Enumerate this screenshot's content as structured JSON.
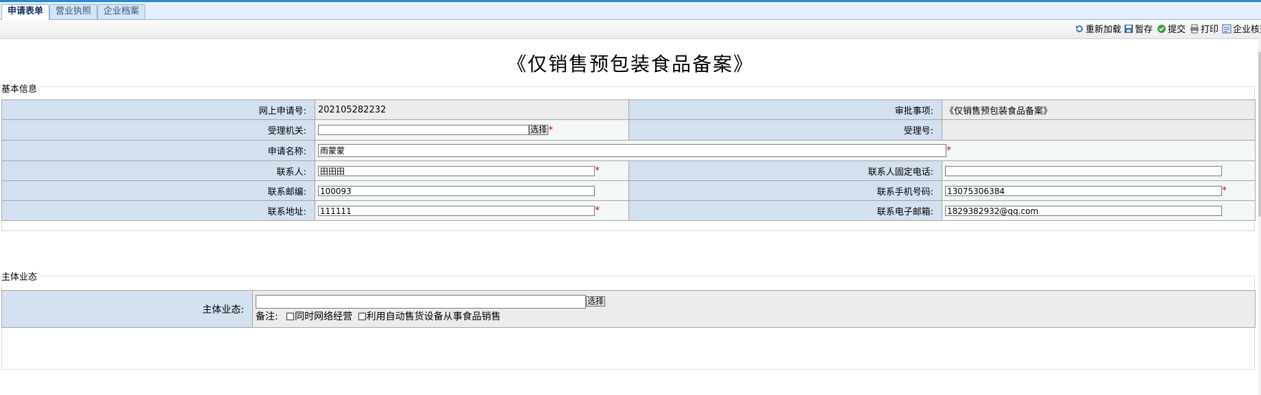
{
  "tabs": [
    {
      "label": "申请表单",
      "active": true
    },
    {
      "label": "营业执照",
      "active": false
    },
    {
      "label": "企业档案",
      "active": false
    }
  ],
  "toolbar": {
    "reload": {
      "label": "重新加载",
      "icon": "reload-icon"
    },
    "save": {
      "label": "暂存",
      "icon": "floppy-disk-icon"
    },
    "submit": {
      "label": "提交",
      "icon": "check-circle-icon"
    },
    "print": {
      "label": "打印",
      "icon": "printer-icon"
    },
    "verify": {
      "label": "企业核查",
      "icon": "document-icon"
    }
  },
  "page_title": "《仅销售预包装食品备案》",
  "basic_info": {
    "legend": "基本信息",
    "online_no_label": "网上申请号:",
    "online_no": "202105282232",
    "approval_item_label": "审批事项:",
    "approval_item": "《仅销售预包装食品备案》",
    "accept_org_label": "受理机关:",
    "accept_org_value": "",
    "select_label": "选择",
    "accept_no_label": "受理号:",
    "accept_no": "",
    "apply_name_label": "申请名称:",
    "apply_name": "雨蒙蒙",
    "contact_label": "联系人:",
    "contact": "田田田",
    "phone_fixed_label": "联系人固定电话:",
    "phone_fixed": "",
    "postcode_label": "联系邮编:",
    "postcode": "100093",
    "mobile_label": "联系手机号码:",
    "mobile": "13075306384",
    "address_label": "联系地址:",
    "address": "111111",
    "email_label": "联系电子邮箱:",
    "email": "1829382932@qq.com",
    "required_mark": "*"
  },
  "business": {
    "legend": "主体业态",
    "label": "主体业态:",
    "value": "",
    "select_label": "选择",
    "note_label": "备注:",
    "option1": "同时网络经营",
    "option2": "利用自动售货设备从事食品销售"
  },
  "colors": {
    "label_bg": "#d3e0ef",
    "tab_border": "#8db2e3",
    "required": "#e00000"
  }
}
